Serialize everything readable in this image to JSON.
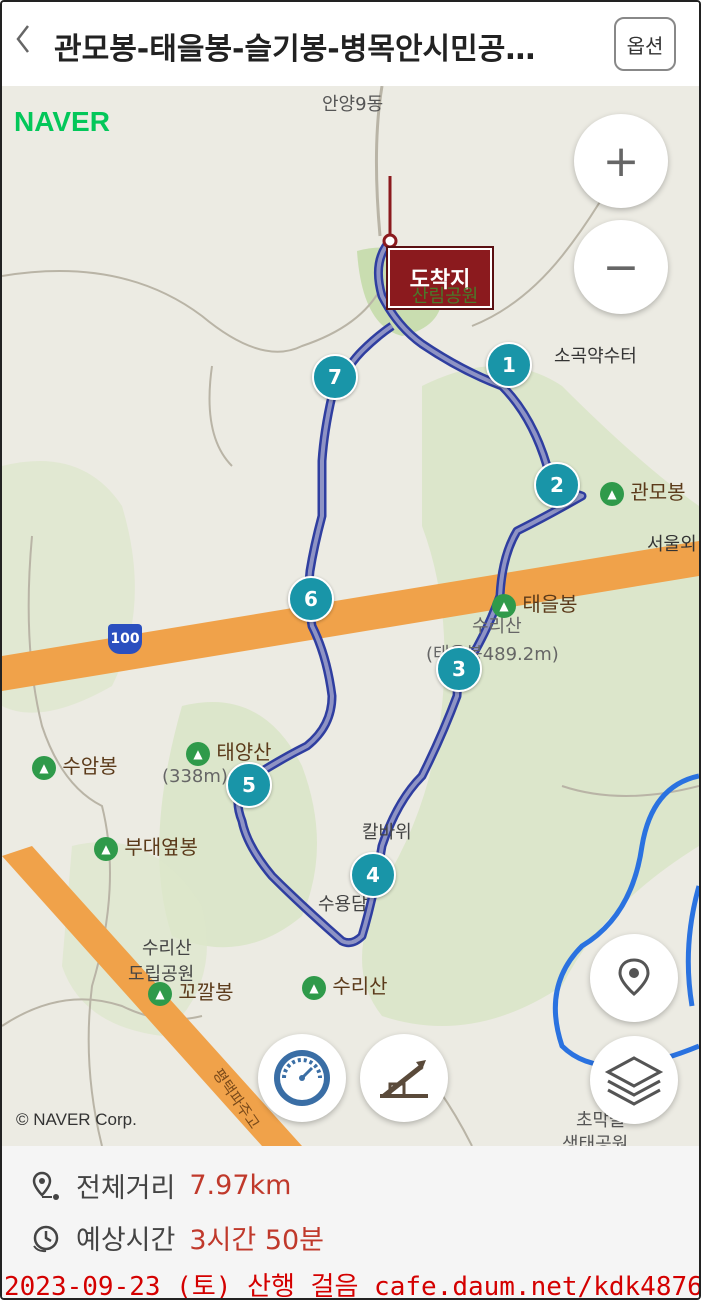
{
  "header": {
    "back_icon": "chevron-left",
    "title": "관모봉-태을봉-슬기봉-병목안시민공…",
    "option_label": "옵션"
  },
  "map": {
    "logo": "NAVER",
    "copyright": "© NAVER Corp.",
    "destination_label": "도착지",
    "waypoints": [
      "1",
      "2",
      "3",
      "4",
      "5",
      "6",
      "7"
    ],
    "peaks": {
      "gwanmobong": "관모봉",
      "taeeulbong": "태을봉",
      "taeyangsan": "태양산",
      "suambong": "수암봉",
      "budaeyeopbong": "부대옆봉",
      "kkokkalbong": "꼬깔봉",
      "surisan": "수리산"
    },
    "places": {
      "anyang9dong": "안양9동",
      "sogok_spring": "소곡약수터",
      "seoul_outer": "서울외",
      "surisan_elev": "(태을봉489.2m)",
      "surisan_top": "수리산",
      "taeyang_elev": "(338m)",
      "kalbawi": "칼바위",
      "suyongdam": "수용담",
      "surisan_park_1": "수리산",
      "surisan_park_2": "도립공원",
      "park_top": "산림공원",
      "chomak_1": "초막골",
      "chomak_2": "생태공원",
      "road_shield": "100",
      "pyeongtaek": "평택파주고"
    },
    "controls": {
      "zoom_in": "+",
      "zoom_out": "−",
      "location_icon": "location-pin-icon",
      "layers_icon": "layers-icon",
      "speed_icon": "speedometer-icon",
      "elevation_icon": "elevation-icon"
    }
  },
  "summary": {
    "distance_label": "전체거리",
    "distance_value": "7.97km",
    "time_label": "예상시간",
    "time_value": "3시간 50분"
  },
  "watermark": "2023-09-23 (토) 산행 걸음  cafe.daum.net/kdk4876"
}
